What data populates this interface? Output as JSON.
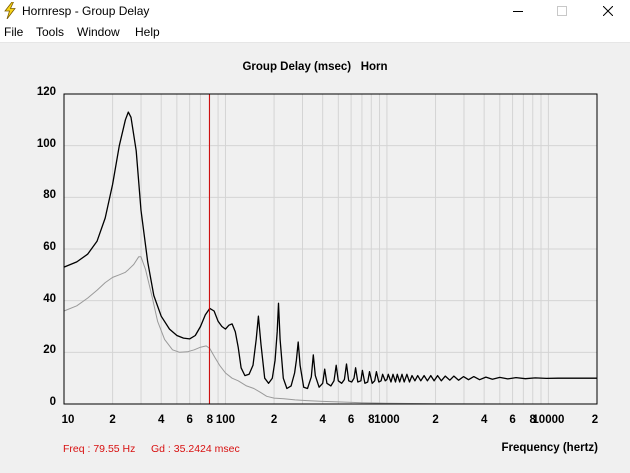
{
  "window": {
    "title": "Hornresp - Group Delay",
    "minimize": "—",
    "maximize": "☐",
    "close": "✕"
  },
  "menu": [
    "File",
    "Tools",
    "Window",
    "Help"
  ],
  "chart_data": {
    "type": "line",
    "title": "Group Delay (msec)   Horn",
    "xlabel": "Frequency (hertz)",
    "ylabel": "",
    "x_scale": "log",
    "xlim": [
      10,
      20000
    ],
    "ylim": [
      0,
      120
    ],
    "y_ticks": [
      0,
      20,
      40,
      60,
      80,
      100,
      120
    ],
    "x_tick_labels": [
      {
        "value": 10,
        "label": "10"
      },
      {
        "value": 20,
        "label": "2"
      },
      {
        "value": 40,
        "label": "4"
      },
      {
        "value": 60,
        "label": "6"
      },
      {
        "value": 80,
        "label": "8"
      },
      {
        "value": 100,
        "label": "100"
      },
      {
        "value": 200,
        "label": "2"
      },
      {
        "value": 400,
        "label": "4"
      },
      {
        "value": 600,
        "label": "6"
      },
      {
        "value": 800,
        "label": "8"
      },
      {
        "value": 1000,
        "label": "1000"
      },
      {
        "value": 2000,
        "label": "2"
      },
      {
        "value": 4000,
        "label": "4"
      },
      {
        "value": 6000,
        "label": "6"
      },
      {
        "value": 8000,
        "label": "8"
      },
      {
        "value": 10000,
        "label": "10000"
      },
      {
        "value": 20000,
        "label": "2"
      }
    ],
    "grid": true,
    "cursor": {
      "x": 79.55,
      "color": "#cc0000"
    },
    "series": [
      {
        "color": "#000000",
        "points": [
          [
            10,
            53
          ],
          [
            12,
            55
          ],
          [
            14,
            58
          ],
          [
            16,
            63
          ],
          [
            18,
            72
          ],
          [
            20,
            85
          ],
          [
            22,
            100
          ],
          [
            24,
            110
          ],
          [
            25,
            113
          ],
          [
            26,
            111
          ],
          [
            28,
            98
          ],
          [
            30,
            75
          ],
          [
            33,
            55
          ],
          [
            36,
            42
          ],
          [
            40,
            34
          ],
          [
            45,
            29
          ],
          [
            50,
            26.5
          ],
          [
            55,
            25.5
          ],
          [
            60,
            25.2
          ],
          [
            65,
            26.5
          ],
          [
            70,
            30
          ],
          [
            75,
            34.5
          ],
          [
            80,
            37
          ],
          [
            85,
            36
          ],
          [
            90,
            32
          ],
          [
            95,
            30
          ],
          [
            100,
            29
          ],
          [
            105,
            30.5
          ],
          [
            110,
            31
          ],
          [
            115,
            28
          ],
          [
            120,
            22
          ],
          [
            125,
            14
          ],
          [
            132,
            11
          ],
          [
            140,
            11.5
          ],
          [
            148,
            15
          ],
          [
            155,
            25
          ],
          [
            160,
            34
          ],
          [
            166,
            23
          ],
          [
            175,
            10
          ],
          [
            185,
            8
          ],
          [
            195,
            10
          ],
          [
            203,
            17
          ],
          [
            209,
            28
          ],
          [
            213,
            39
          ],
          [
            218,
            25
          ],
          [
            228,
            10
          ],
          [
            240,
            6
          ],
          [
            255,
            7
          ],
          [
            268,
            12
          ],
          [
            275,
            17
          ],
          [
            282,
            24
          ],
          [
            290,
            15
          ],
          [
            305,
            6.5
          ],
          [
            322,
            6
          ],
          [
            340,
            10.5
          ],
          [
            350,
            19
          ],
          [
            360,
            11
          ],
          [
            380,
            6.5
          ],
          [
            400,
            8
          ],
          [
            412,
            13.5
          ],
          [
            425,
            8
          ],
          [
            450,
            7
          ],
          [
            470,
            9
          ],
          [
            485,
            15
          ],
          [
            500,
            9
          ],
          [
            525,
            8
          ],
          [
            545,
            9.5
          ],
          [
            562,
            15.5
          ],
          [
            580,
            9
          ],
          [
            605,
            8.5
          ],
          [
            625,
            10
          ],
          [
            640,
            14
          ],
          [
            660,
            8.5
          ],
          [
            690,
            9
          ],
          [
            705,
            13
          ],
          [
            730,
            8
          ],
          [
            760,
            8.5
          ],
          [
            780,
            12.5
          ],
          [
            810,
            8
          ],
          [
            840,
            9
          ],
          [
            860,
            12.5
          ],
          [
            890,
            8.5
          ],
          [
            920,
            9
          ],
          [
            940,
            11.5
          ],
          [
            975,
            9
          ],
          [
            1000,
            9.5
          ],
          [
            1020,
            11.5
          ],
          [
            1060,
            8.5
          ],
          [
            1090,
            11.5
          ],
          [
            1130,
            8.5
          ],
          [
            1160,
            11.5
          ],
          [
            1200,
            8.5
          ],
          [
            1240,
            11.5
          ],
          [
            1280,
            8.5
          ],
          [
            1330,
            11.5
          ],
          [
            1380,
            8.5
          ],
          [
            1430,
            11
          ],
          [
            1490,
            9
          ],
          [
            1550,
            11
          ],
          [
            1620,
            9
          ],
          [
            1700,
            11
          ],
          [
            1780,
            9
          ],
          [
            1870,
            11
          ],
          [
            1960,
            9
          ],
          [
            2060,
            11
          ],
          [
            2170,
            9
          ],
          [
            2300,
            10.8
          ],
          [
            2450,
            9.2
          ],
          [
            2600,
            10.8
          ],
          [
            2780,
            9.2
          ],
          [
            2980,
            10.6
          ],
          [
            3200,
            9.4
          ],
          [
            3450,
            10.6
          ],
          [
            3750,
            9.4
          ],
          [
            4100,
            10.4
          ],
          [
            4500,
            9.6
          ],
          [
            5000,
            10.3
          ],
          [
            5600,
            9.7
          ],
          [
            6300,
            10.2
          ],
          [
            7200,
            9.8
          ],
          [
            8300,
            10.1
          ],
          [
            9700,
            9.9
          ],
          [
            11500,
            10
          ],
          [
            14000,
            10
          ],
          [
            17000,
            10
          ],
          [
            20000,
            10
          ]
        ]
      },
      {
        "color": "#9a9a9a",
        "points": [
          [
            10,
            36
          ],
          [
            12,
            38
          ],
          [
            14,
            41
          ],
          [
            16,
            44
          ],
          [
            18,
            47
          ],
          [
            20,
            49
          ],
          [
            22,
            50
          ],
          [
            24,
            51
          ],
          [
            25,
            52
          ],
          [
            27,
            54
          ],
          [
            29,
            57
          ],
          [
            30,
            57
          ],
          [
            32,
            52
          ],
          [
            35,
            42
          ],
          [
            38,
            32
          ],
          [
            42,
            25
          ],
          [
            47,
            21
          ],
          [
            52,
            20
          ],
          [
            58,
            20.2
          ],
          [
            64,
            21
          ],
          [
            70,
            22
          ],
          [
            76,
            22.5
          ],
          [
            80,
            21.5
          ],
          [
            86,
            18
          ],
          [
            92,
            15
          ],
          [
            100,
            12
          ],
          [
            110,
            10
          ],
          [
            120,
            9
          ],
          [
            135,
            7
          ],
          [
            150,
            6
          ],
          [
            165,
            4.5
          ],
          [
            180,
            3
          ],
          [
            200,
            2.3
          ],
          [
            230,
            2
          ],
          [
            270,
            1.6
          ],
          [
            320,
            1.3
          ],
          [
            400,
            1
          ],
          [
            500,
            0.8
          ],
          [
            700,
            0.5
          ],
          [
            1000,
            0.3
          ],
          [
            2000,
            0.1
          ],
          [
            5000,
            0
          ],
          [
            20000,
            0
          ]
        ]
      }
    ]
  },
  "readout": {
    "freq": "Freq : 79.55 Hz",
    "gd": "Gd : 35.2424 msec"
  }
}
